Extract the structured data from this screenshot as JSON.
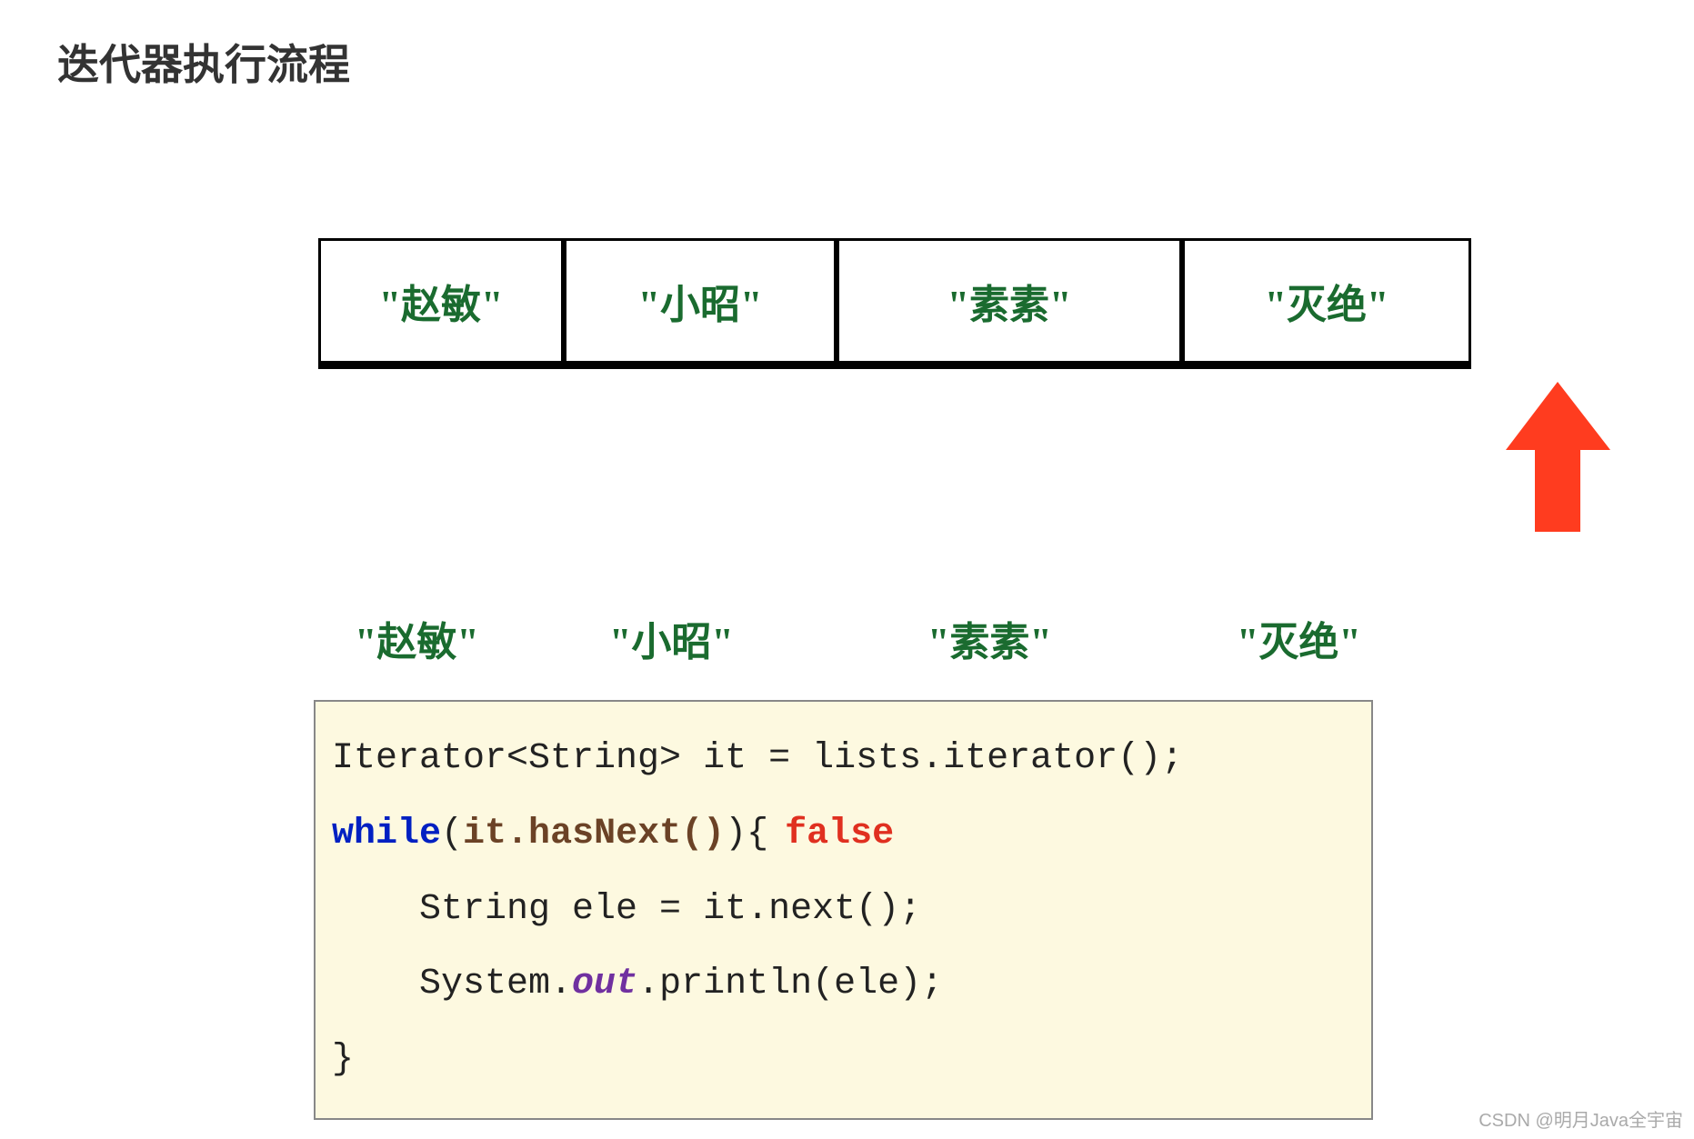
{
  "title": "迭代器执行流程",
  "array": [
    "\"赵敏\"",
    "\"小昭\"",
    "\"素素\"",
    "\"灭绝\""
  ],
  "output": [
    "\"赵敏\"",
    "\"小昭\"",
    "\"素素\"",
    "\"灭绝\""
  ],
  "code": {
    "line1": "Iterator<String> it = lists.iterator();",
    "while_kw": "while",
    "while_open": "(",
    "hasnext": "it.hasNext()",
    "while_close": "){",
    "false_label": "false",
    "line3": "    String ele = it.next();",
    "line4_a": "    System.",
    "line4_out": "out",
    "line4_b": ".println(ele);",
    "line5": "}"
  },
  "watermark": "CSDN @明月Java全宇宙",
  "icons": {
    "arrow": "up-arrow"
  },
  "colors": {
    "accent_red": "#ff3c1f",
    "string_green": "#1a6b2f",
    "code_bg": "#fdf9e0"
  }
}
